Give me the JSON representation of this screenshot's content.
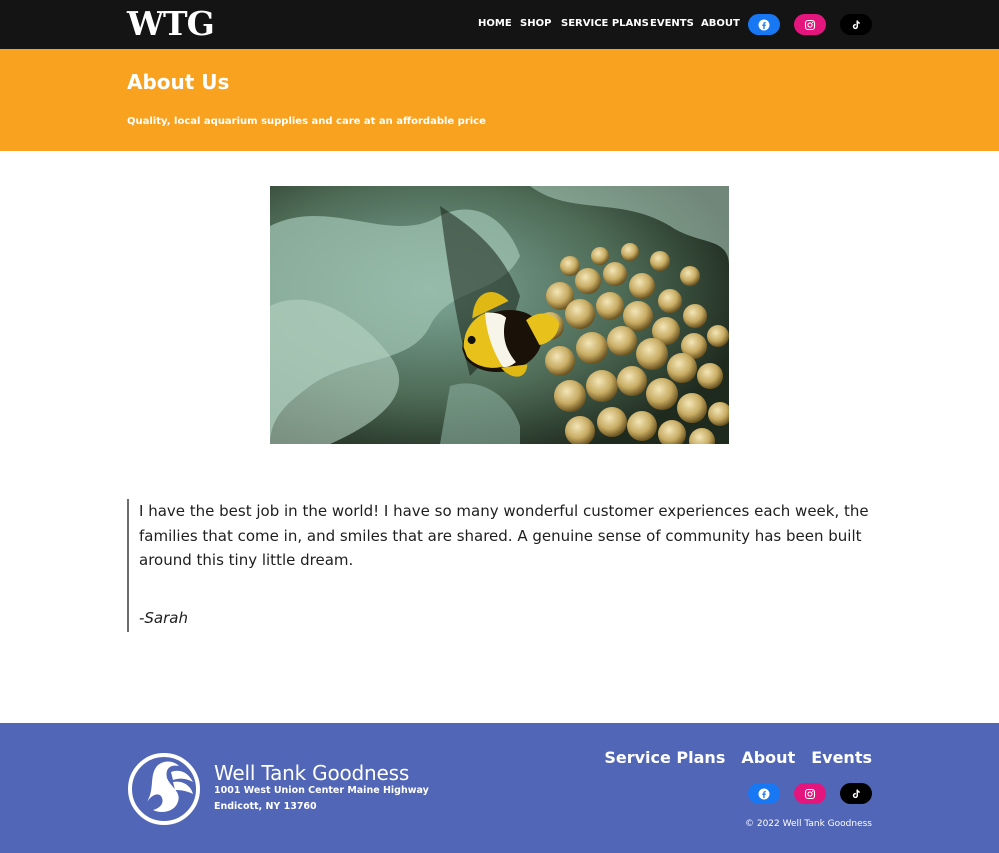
{
  "header": {
    "logo_text": "WTG",
    "nav": [
      {
        "label": "HOME"
      },
      {
        "label": "SHOP"
      },
      {
        "label": "SERVICE PLANS"
      },
      {
        "label": "EVENTS"
      },
      {
        "label": "ABOUT"
      }
    ],
    "social": [
      {
        "icon": "facebook-icon",
        "color": "#1877f2"
      },
      {
        "icon": "instagram-icon",
        "color": "#e4167e"
      },
      {
        "icon": "tiktok-icon",
        "color": "#000000"
      }
    ]
  },
  "banner": {
    "title": "About Us",
    "subtitle": "Quality, local aquarium supplies and care at an affordable price",
    "color": "#f8a21f"
  },
  "photo": {
    "alt": "clownfish-in-anemone"
  },
  "quote": {
    "text": "I have the best job in the world! I have so many wonderful customer experiences each week, the families that come in, and smiles that are shared. A genuine sense of community has been built around this tiny little dream.",
    "author": "-Sarah"
  },
  "footer": {
    "brand_name": "Well Tank Goodness",
    "address_line1": "1001 West Union Center Maine Highway",
    "address_line2": "Endicott, NY 13760",
    "links": [
      {
        "label": "Service Plans"
      },
      {
        "label": "About"
      },
      {
        "label": "Events"
      }
    ],
    "social": [
      {
        "icon": "facebook-icon",
        "color": "#1877f2"
      },
      {
        "icon": "instagram-icon",
        "color": "#e4167e"
      },
      {
        "icon": "tiktok-icon",
        "color": "#000000"
      }
    ],
    "copyright": "© 2022 Well Tank Goodness",
    "color": "#5166b6"
  }
}
